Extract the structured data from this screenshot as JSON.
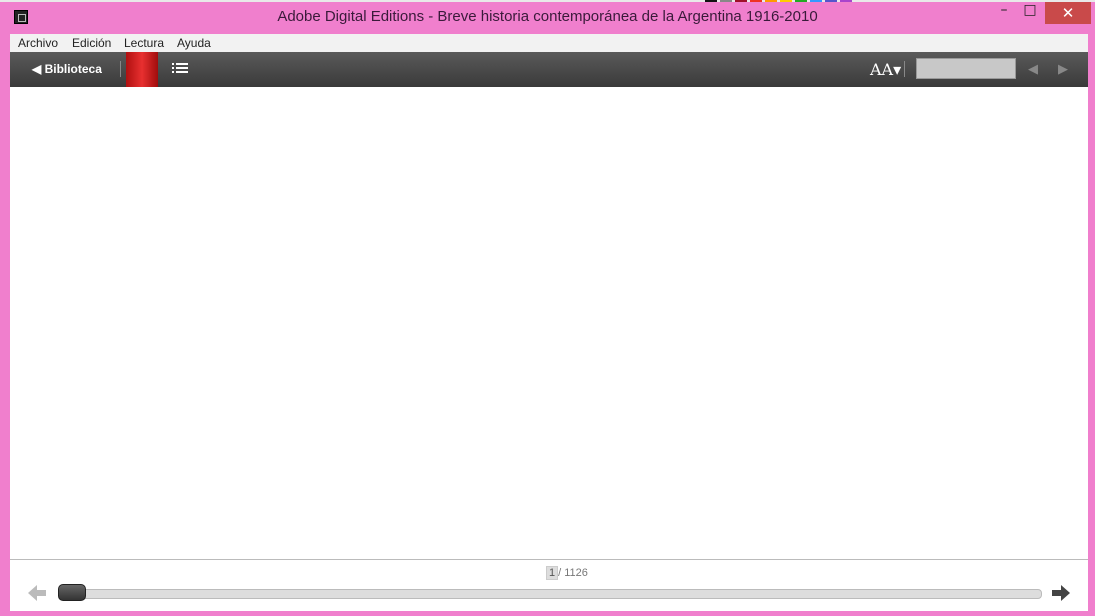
{
  "window": {
    "title": "Adobe Digital Editions - Breve historia contemporánea de la Argentina 1916-2010",
    "controls": {
      "minimize": "–",
      "maximize": "□",
      "close": "✕"
    }
  },
  "menu": {
    "items": [
      {
        "label": "Archivo",
        "id": "archivo"
      },
      {
        "label": "Edición",
        "id": "edicion"
      },
      {
        "label": "Lectura",
        "id": "lectura"
      },
      {
        "label": "Ayuda",
        "id": "ayuda"
      }
    ]
  },
  "toolbar": {
    "library_label": "◀ Biblioteca",
    "font_size_label": "AA▾",
    "search_value": "",
    "bookmark_color": "#d62020"
  },
  "footer": {
    "current_page": "1",
    "total_pages": "/ 1126",
    "progress_fraction": 0.001
  }
}
